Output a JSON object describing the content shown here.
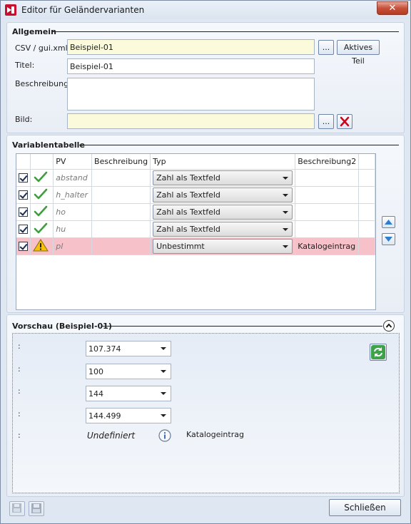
{
  "window": {
    "title": "Editor für Geländervarianten",
    "close_symbol": "✕"
  },
  "allgemein": {
    "header": "Allgemein",
    "csv_label": "CSV / gui.xml:",
    "csv_value": "Beispiel-01",
    "browse_label": "...",
    "aktives_teil_label": "Aktives Teil",
    "titel_label": "Titel:",
    "titel_value": "Beispiel-01",
    "beschreibung_label": "Beschreibung:",
    "beschreibung_value": "",
    "bild_label": "Bild:",
    "bild_value": "",
    "bild_browse_label": "..."
  },
  "variablentabelle": {
    "header": "Variablentabelle",
    "columns": [
      "",
      "",
      "PV",
      "Beschreibung",
      "Typ",
      "Beschreibung2"
    ],
    "rows": [
      {
        "pv": "abstand",
        "beschreibung": "",
        "typ": "Zahl als Textfeld",
        "beschreibung2": "",
        "status": "ok"
      },
      {
        "pv": "h_halter",
        "beschreibung": "",
        "typ": "Zahl als Textfeld",
        "beschreibung2": "",
        "status": "ok"
      },
      {
        "pv": "ho",
        "beschreibung": "",
        "typ": "Zahl als Textfeld",
        "beschreibung2": "",
        "status": "ok"
      },
      {
        "pv": "hu",
        "beschreibung": "",
        "typ": "Zahl als Textfeld",
        "beschreibung2": "",
        "status": "ok"
      },
      {
        "pv": "pl",
        "beschreibung": "",
        "typ": "Unbestimmt",
        "beschreibung2": "Katalogeintrag",
        "status": "warning"
      }
    ]
  },
  "vorschau": {
    "header": "Vorschau (Beispiel-01)",
    "rows": [
      {
        "label": ":",
        "value": "107.374"
      },
      {
        "label": ":",
        "value": "100"
      },
      {
        "label": ":",
        "value": "144"
      },
      {
        "label": ":",
        "value": "144.499"
      },
      {
        "label": ":",
        "value": "Undefiniert",
        "note": "Katalogeintrag"
      }
    ]
  },
  "footer": {
    "close_label": "Schließen"
  },
  "colors": {
    "warning_row": "#f7c1ca",
    "input_yellow": "#fbfbdc",
    "check_green": "#3aa03a"
  }
}
